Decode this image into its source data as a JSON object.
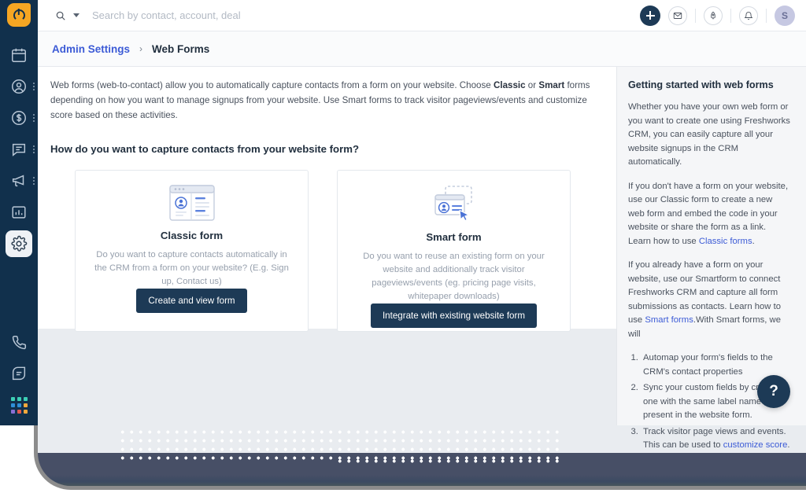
{
  "brand": {
    "logo_icon": "freshworks-logo-icon",
    "accent_orange": "#f5a623",
    "primary_dark": "#1d3a56",
    "link_blue": "#3c5bd6"
  },
  "search": {
    "placeholder": "Search by contact, account, deal",
    "value": "",
    "icon": "search-icon",
    "caret_icon": "chevron-down-icon"
  },
  "topbar": {
    "add_icon": "plus-icon",
    "mail_icon": "envelope-icon",
    "rocket_icon": "rocket-icon",
    "bell_icon": "bell-icon",
    "avatar_initial": "S"
  },
  "sidebar": {
    "items": [
      {
        "label": "Calendar",
        "icon": "calendar-icon",
        "has_overflow": false,
        "active": false
      },
      {
        "label": "Contacts",
        "icon": "contact-circle-icon",
        "has_overflow": true,
        "active": false
      },
      {
        "label": "Deals",
        "icon": "dollar-circle-icon",
        "has_overflow": true,
        "active": false
      },
      {
        "label": "Conversations",
        "icon": "chat-bubble-icon",
        "has_overflow": true,
        "active": false
      },
      {
        "label": "Campaigns",
        "icon": "megaphone-icon",
        "has_overflow": true,
        "active": false
      },
      {
        "label": "Reports",
        "icon": "bar-chart-icon",
        "has_overflow": false,
        "active": false
      },
      {
        "label": "Admin Settings",
        "icon": "gear-icon",
        "has_overflow": false,
        "active": true
      }
    ],
    "bottom_items": [
      {
        "label": "Phone",
        "icon": "phone-icon"
      },
      {
        "label": "Notes",
        "icon": "note-leaf-icon"
      }
    ],
    "app_switcher": {
      "label": "App switcher",
      "icon": "app-grid-icon",
      "colors": [
        "#3dcfb6",
        "#3dcfb6",
        "#3dcfb6",
        "#2f8fd8",
        "#2f8fd8",
        "#f2a83c",
        "#8a6fd4",
        "#e2594f",
        "#f2a83c"
      ]
    }
  },
  "breadcrumb": {
    "parent": "Admin Settings",
    "separator": "›",
    "current": "Web Forms"
  },
  "main": {
    "intro_part1": "Web forms (web-to-contact) allow you to automatically capture contacts from a form on your website. Choose ",
    "intro_bold1": "Classic",
    "intro_part2": " or ",
    "intro_bold2": "Smart",
    "intro_part3": " forms depending on how you want to manage signups from your website. Use Smart forms to track visitor pageviews/events and customize score based on these activities.",
    "question": "How do you want to capture contacts from your website form?",
    "cards": [
      {
        "id": "classic-form",
        "art_icon": "browser-form-illustration",
        "title": "Classic form",
        "description": "Do you want to capture contacts automatically in the CRM from a form on your website? (E.g. Sign up, Contact us)",
        "button_label": "Create and view form"
      },
      {
        "id": "smart-form",
        "art_icon": "smart-form-cursor-illustration",
        "title": "Smart form",
        "description": "Do you want to reuse an existing form on your website and additionally track visitor pageviews/events (eg. pricing page visits, whitepaper downloads)",
        "button_label": "Integrate with existing website form"
      }
    ]
  },
  "right_panel": {
    "title": "Getting started with web forms",
    "p1": "Whether you have your own web form or you want to create one using Freshworks CRM, you can easily capture all your website signups in the CRM automatically.",
    "p2_before": "If you don't have a form on your website, use our Classic form to create a new web form and embed the code in your website or share the form as a link. Learn how to use ",
    "p2_link": "Classic forms",
    "p2_after": ".",
    "p3_before": "If you already have a form on your website, use our Smartform to connect Freshworks CRM and capture all form submissions as contacts. Learn how to use ",
    "p3_link": "Smart forms",
    "p3_after": ".With Smart forms, we will",
    "list": [
      {
        "text_before": "Automap your form's fields to the CRM's contact properties",
        "link": "",
        "text_after": ""
      },
      {
        "text_before": "Sync your custom fields by creating one with the same label name present in the website form.",
        "link": "",
        "text_after": ""
      },
      {
        "text_before": "Track visitor page views and events. This can be used to ",
        "link": "customize score",
        "text_after": "."
      }
    ],
    "help_label": "?"
  }
}
